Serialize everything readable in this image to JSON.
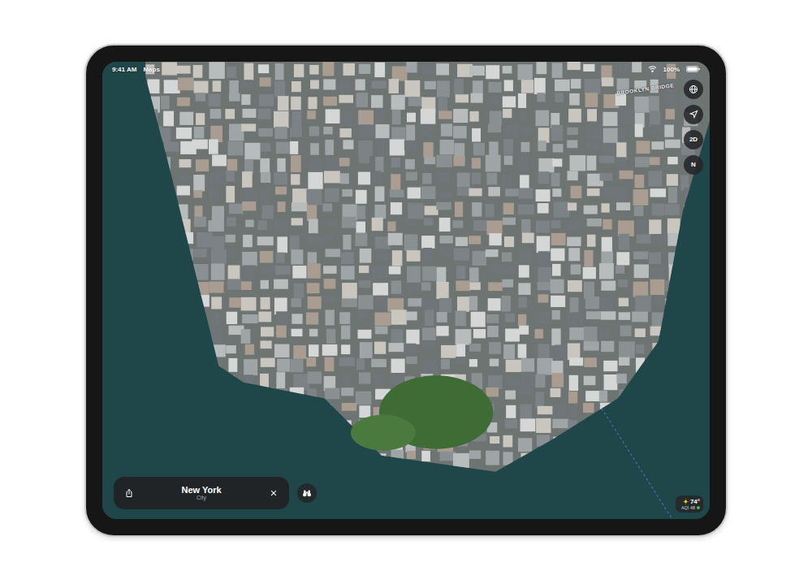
{
  "status_bar": {
    "time": "9:41 AM",
    "app": "Maps",
    "battery": "100%"
  },
  "map": {
    "labels": [
      {
        "text": "BROOKLYN BRIDGE"
      }
    ]
  },
  "map_controls": {
    "view_mode": "2D",
    "compass": "N"
  },
  "place_card": {
    "title": "New York",
    "subtitle": "City"
  },
  "weather": {
    "temperature": "74°",
    "aqi": "AQI 48"
  }
}
